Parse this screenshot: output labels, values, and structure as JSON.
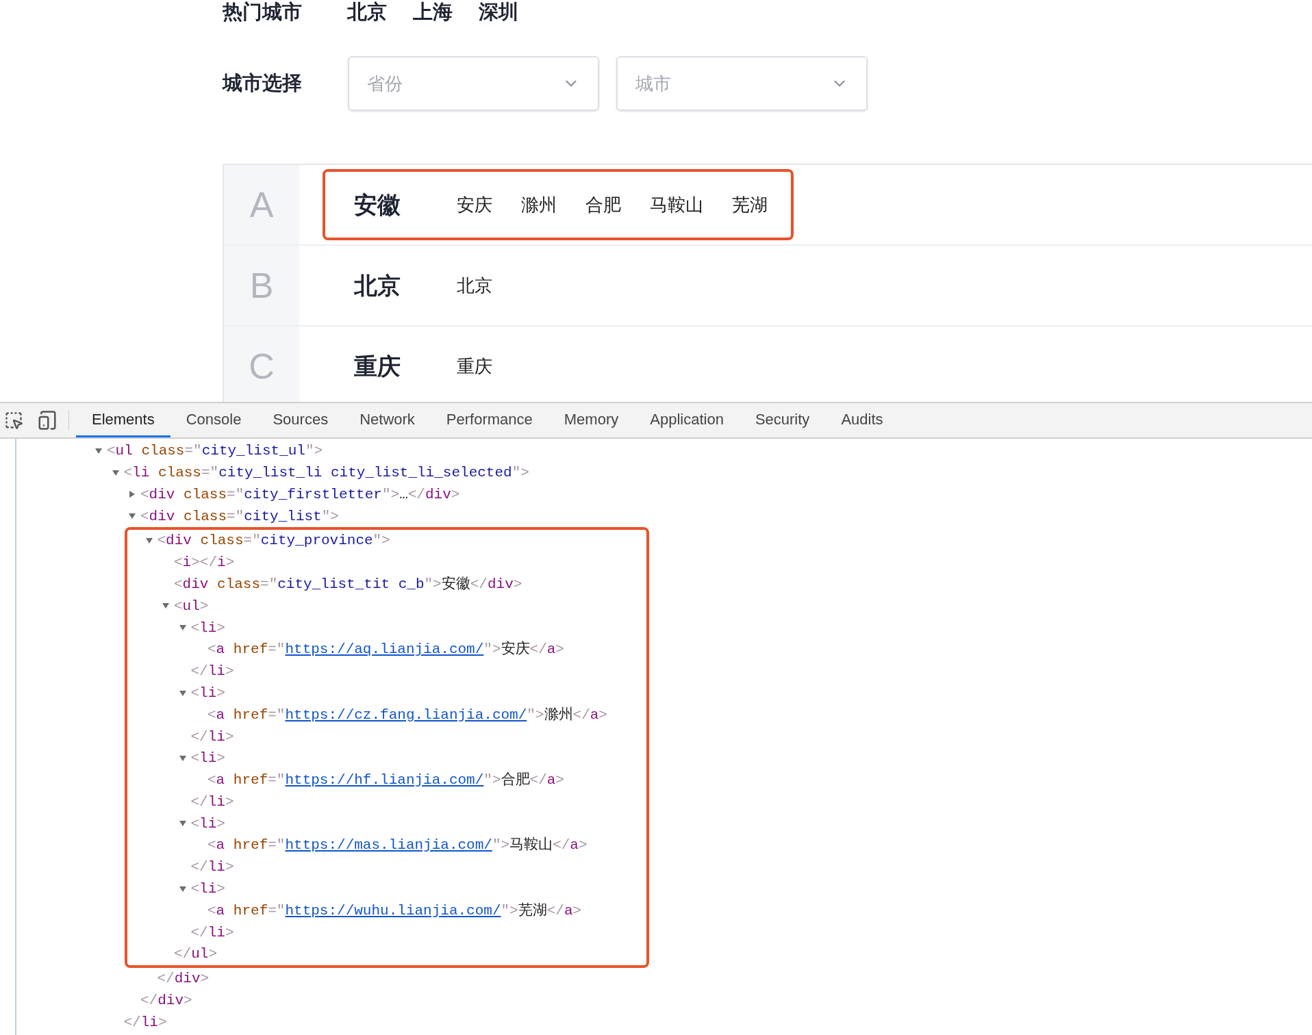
{
  "hot_cities": {
    "label": "热门城市",
    "cities": [
      "北京",
      "上海",
      "深圳"
    ]
  },
  "city_select": {
    "label": "城市选择",
    "selects": [
      {
        "placeholder": "省份"
      },
      {
        "placeholder": "城市"
      }
    ]
  },
  "city_list": [
    {
      "letter": "A",
      "province": "安徽",
      "cities": [
        "安庆",
        "滁州",
        "合肥",
        "马鞍山",
        "芜湖"
      ],
      "highlighted": true
    },
    {
      "letter": "B",
      "province": "北京",
      "cities": [
        "北京"
      ],
      "highlighted": false
    },
    {
      "letter": "C",
      "province": "重庆",
      "cities": [
        "重庆"
      ],
      "highlighted": false
    }
  ],
  "devtools": {
    "tabs": [
      {
        "label": "Elements",
        "selected": true
      },
      {
        "label": "Console",
        "selected": false
      },
      {
        "label": "Sources",
        "selected": false
      },
      {
        "label": "Network",
        "selected": false
      },
      {
        "label": "Performance",
        "selected": false
      },
      {
        "label": "Memory",
        "selected": false
      },
      {
        "label": "Application",
        "selected": false
      },
      {
        "label": "Security",
        "selected": false
      },
      {
        "label": "Audits",
        "selected": false
      }
    ],
    "dom_tree": [
      {
        "expanded": true,
        "tokens": [
          {
            "kind": "punct",
            "text": "<"
          },
          {
            "kind": "tag",
            "text": "ul"
          },
          {
            "kind": "attr",
            "text": " class"
          },
          {
            "kind": "punct",
            "text": "=\""
          },
          {
            "kind": "value",
            "text": "city_list_ul"
          },
          {
            "kind": "punct",
            "text": "\">"
          }
        ],
        "children": [
          {
            "expanded": true,
            "tokens": [
              {
                "kind": "punct",
                "text": "<"
              },
              {
                "kind": "tag",
                "text": "li"
              },
              {
                "kind": "attr",
                "text": " class"
              },
              {
                "kind": "punct",
                "text": "=\""
              },
              {
                "kind": "value",
                "text": "city_list_li city_list_li_selected"
              },
              {
                "kind": "punct",
                "text": "\">"
              }
            ],
            "close": [
              {
                "kind": "punct",
                "text": "</"
              },
              {
                "kind": "tag",
                "text": "li"
              },
              {
                "kind": "punct",
                "text": ">"
              }
            ],
            "children": [
              {
                "expanded": false,
                "tokens": [
                  {
                    "kind": "punct",
                    "text": "<"
                  },
                  {
                    "kind": "tag",
                    "text": "div"
                  },
                  {
                    "kind": "attr",
                    "text": " class"
                  },
                  {
                    "kind": "punct",
                    "text": "=\""
                  },
                  {
                    "kind": "value",
                    "text": "city_firstletter"
                  },
                  {
                    "kind": "punct",
                    "text": "\">"
                  },
                  {
                    "kind": "text",
                    "text": "…"
                  },
                  {
                    "kind": "punct",
                    "text": "</"
                  },
                  {
                    "kind": "tag",
                    "text": "div"
                  },
                  {
                    "kind": "punct",
                    "text": ">"
                  }
                ]
              },
              {
                "expanded": true,
                "tokens": [
                  {
                    "kind": "punct",
                    "text": "<"
                  },
                  {
                    "kind": "tag",
                    "text": "div"
                  },
                  {
                    "kind": "attr",
                    "text": " class"
                  },
                  {
                    "kind": "punct",
                    "text": "=\""
                  },
                  {
                    "kind": "value",
                    "text": "city_list"
                  },
                  {
                    "kind": "punct",
                    "text": "\">"
                  }
                ],
                "close": [
                  {
                    "kind": "punct",
                    "text": "</"
                  },
                  {
                    "kind": "tag",
                    "text": "div"
                  },
                  {
                    "kind": "punct",
                    "text": ">"
                  }
                ],
                "children": [
                  {
                    "expanded": true,
                    "highlighted": true,
                    "tokens": [
                      {
                        "kind": "punct",
                        "text": "<"
                      },
                      {
                        "kind": "tag",
                        "text": "div"
                      },
                      {
                        "kind": "attr",
                        "text": " class"
                      },
                      {
                        "kind": "punct",
                        "text": "=\""
                      },
                      {
                        "kind": "value",
                        "text": "city_province"
                      },
                      {
                        "kind": "punct",
                        "text": "\">"
                      }
                    ],
                    "close": [
                      {
                        "kind": "punct",
                        "text": "</"
                      },
                      {
                        "kind": "tag",
                        "text": "div"
                      },
                      {
                        "kind": "punct",
                        "text": ">"
                      }
                    ],
                    "children": [
                      {
                        "tokens": [
                          {
                            "kind": "punct",
                            "text": "<"
                          },
                          {
                            "kind": "tag",
                            "text": "i"
                          },
                          {
                            "kind": "punct",
                            "text": "></"
                          },
                          {
                            "kind": "tag",
                            "text": "i"
                          },
                          {
                            "kind": "punct",
                            "text": ">"
                          }
                        ]
                      },
                      {
                        "tokens": [
                          {
                            "kind": "punct",
                            "text": "<"
                          },
                          {
                            "kind": "tag",
                            "text": "div"
                          },
                          {
                            "kind": "attr",
                            "text": " class"
                          },
                          {
                            "kind": "punct",
                            "text": "=\""
                          },
                          {
                            "kind": "value",
                            "text": "city_list_tit c_b"
                          },
                          {
                            "kind": "punct",
                            "text": "\">"
                          },
                          {
                            "kind": "text",
                            "text": "安徽"
                          },
                          {
                            "kind": "punct",
                            "text": "</"
                          },
                          {
                            "kind": "tag",
                            "text": "div"
                          },
                          {
                            "kind": "punct",
                            "text": ">"
                          }
                        ]
                      },
                      {
                        "expanded": true,
                        "tokens": [
                          {
                            "kind": "punct",
                            "text": "<"
                          },
                          {
                            "kind": "tag",
                            "text": "ul"
                          },
                          {
                            "kind": "punct",
                            "text": ">"
                          }
                        ],
                        "close": [
                          {
                            "kind": "punct",
                            "text": "</"
                          },
                          {
                            "kind": "tag",
                            "text": "ul"
                          },
                          {
                            "kind": "punct",
                            "text": ">"
                          }
                        ],
                        "children": [
                          {
                            "expanded": true,
                            "tokens": [
                              {
                                "kind": "punct",
                                "text": "<"
                              },
                              {
                                "kind": "tag",
                                "text": "li"
                              },
                              {
                                "kind": "punct",
                                "text": ">"
                              }
                            ],
                            "close": [
                              {
                                "kind": "punct",
                                "text": "</"
                              },
                              {
                                "kind": "tag",
                                "text": "li"
                              },
                              {
                                "kind": "punct",
                                "text": ">"
                              }
                            ],
                            "children": [
                              {
                                "tokens": [
                                  {
                                    "kind": "punct",
                                    "text": "<"
                                  },
                                  {
                                    "kind": "tag",
                                    "text": "a"
                                  },
                                  {
                                    "kind": "attr",
                                    "text": " href"
                                  },
                                  {
                                    "kind": "punct",
                                    "text": "=\""
                                  },
                                  {
                                    "kind": "link",
                                    "text": "https://aq.lianjia.com/"
                                  },
                                  {
                                    "kind": "punct",
                                    "text": "\">"
                                  },
                                  {
                                    "kind": "text",
                                    "text": "安庆"
                                  },
                                  {
                                    "kind": "punct",
                                    "text": "</"
                                  },
                                  {
                                    "kind": "tag",
                                    "text": "a"
                                  },
                                  {
                                    "kind": "punct",
                                    "text": ">"
                                  }
                                ]
                              }
                            ]
                          },
                          {
                            "expanded": true,
                            "tokens": [
                              {
                                "kind": "punct",
                                "text": "<"
                              },
                              {
                                "kind": "tag",
                                "text": "li"
                              },
                              {
                                "kind": "punct",
                                "text": ">"
                              }
                            ],
                            "close": [
                              {
                                "kind": "punct",
                                "text": "</"
                              },
                              {
                                "kind": "tag",
                                "text": "li"
                              },
                              {
                                "kind": "punct",
                                "text": ">"
                              }
                            ],
                            "children": [
                              {
                                "tokens": [
                                  {
                                    "kind": "punct",
                                    "text": "<"
                                  },
                                  {
                                    "kind": "tag",
                                    "text": "a"
                                  },
                                  {
                                    "kind": "attr",
                                    "text": " href"
                                  },
                                  {
                                    "kind": "punct",
                                    "text": "=\""
                                  },
                                  {
                                    "kind": "link",
                                    "text": "https://cz.fang.lianjia.com/"
                                  },
                                  {
                                    "kind": "punct",
                                    "text": "\">"
                                  },
                                  {
                                    "kind": "text",
                                    "text": "滁州"
                                  },
                                  {
                                    "kind": "punct",
                                    "text": "</"
                                  },
                                  {
                                    "kind": "tag",
                                    "text": "a"
                                  },
                                  {
                                    "kind": "punct",
                                    "text": ">"
                                  }
                                ]
                              }
                            ]
                          },
                          {
                            "expanded": true,
                            "tokens": [
                              {
                                "kind": "punct",
                                "text": "<"
                              },
                              {
                                "kind": "tag",
                                "text": "li"
                              },
                              {
                                "kind": "punct",
                                "text": ">"
                              }
                            ],
                            "close": [
                              {
                                "kind": "punct",
                                "text": "</"
                              },
                              {
                                "kind": "tag",
                                "text": "li"
                              },
                              {
                                "kind": "punct",
                                "text": ">"
                              }
                            ],
                            "children": [
                              {
                                "tokens": [
                                  {
                                    "kind": "punct",
                                    "text": "<"
                                  },
                                  {
                                    "kind": "tag",
                                    "text": "a"
                                  },
                                  {
                                    "kind": "attr",
                                    "text": " href"
                                  },
                                  {
                                    "kind": "punct",
                                    "text": "=\""
                                  },
                                  {
                                    "kind": "link",
                                    "text": "https://hf.lianjia.com/"
                                  },
                                  {
                                    "kind": "punct",
                                    "text": "\">"
                                  },
                                  {
                                    "kind": "text",
                                    "text": "合肥"
                                  },
                                  {
                                    "kind": "punct",
                                    "text": "</"
                                  },
                                  {
                                    "kind": "tag",
                                    "text": "a"
                                  },
                                  {
                                    "kind": "punct",
                                    "text": ">"
                                  }
                                ]
                              }
                            ]
                          },
                          {
                            "expanded": true,
                            "tokens": [
                              {
                                "kind": "punct",
                                "text": "<"
                              },
                              {
                                "kind": "tag",
                                "text": "li"
                              },
                              {
                                "kind": "punct",
                                "text": ">"
                              }
                            ],
                            "close": [
                              {
                                "kind": "punct",
                                "text": "</"
                              },
                              {
                                "kind": "tag",
                                "text": "li"
                              },
                              {
                                "kind": "punct",
                                "text": ">"
                              }
                            ],
                            "children": [
                              {
                                "tokens": [
                                  {
                                    "kind": "punct",
                                    "text": "<"
                                  },
                                  {
                                    "kind": "tag",
                                    "text": "a"
                                  },
                                  {
                                    "kind": "attr",
                                    "text": " href"
                                  },
                                  {
                                    "kind": "punct",
                                    "text": "=\""
                                  },
                                  {
                                    "kind": "link",
                                    "text": "https://mas.lianjia.com/"
                                  },
                                  {
                                    "kind": "punct",
                                    "text": "\">"
                                  },
                                  {
                                    "kind": "text",
                                    "text": "马鞍山"
                                  },
                                  {
                                    "kind": "punct",
                                    "text": "</"
                                  },
                                  {
                                    "kind": "tag",
                                    "text": "a"
                                  },
                                  {
                                    "kind": "punct",
                                    "text": ">"
                                  }
                                ]
                              }
                            ]
                          },
                          {
                            "expanded": true,
                            "tokens": [
                              {
                                "kind": "punct",
                                "text": "<"
                              },
                              {
                                "kind": "tag",
                                "text": "li"
                              },
                              {
                                "kind": "punct",
                                "text": ">"
                              }
                            ],
                            "close": [
                              {
                                "kind": "punct",
                                "text": "</"
                              },
                              {
                                "kind": "tag",
                                "text": "li"
                              },
                              {
                                "kind": "punct",
                                "text": ">"
                              }
                            ],
                            "children": [
                              {
                                "tokens": [
                                  {
                                    "kind": "punct",
                                    "text": "<"
                                  },
                                  {
                                    "kind": "tag",
                                    "text": "a"
                                  },
                                  {
                                    "kind": "attr",
                                    "text": " href"
                                  },
                                  {
                                    "kind": "punct",
                                    "text": "=\""
                                  },
                                  {
                                    "kind": "link",
                                    "text": "https://wuhu.lianjia.com/"
                                  },
                                  {
                                    "kind": "punct",
                                    "text": "\">"
                                  },
                                  {
                                    "kind": "text",
                                    "text": "芜湖"
                                  },
                                  {
                                    "kind": "punct",
                                    "text": "</"
                                  },
                                  {
                                    "kind": "tag",
                                    "text": "a"
                                  },
                                  {
                                    "kind": "punct",
                                    "text": ">"
                                  }
                                ]
                              }
                            ]
                          }
                        ]
                      }
                    ]
                  }
                ]
              }
            ]
          }
        ]
      }
    ]
  }
}
